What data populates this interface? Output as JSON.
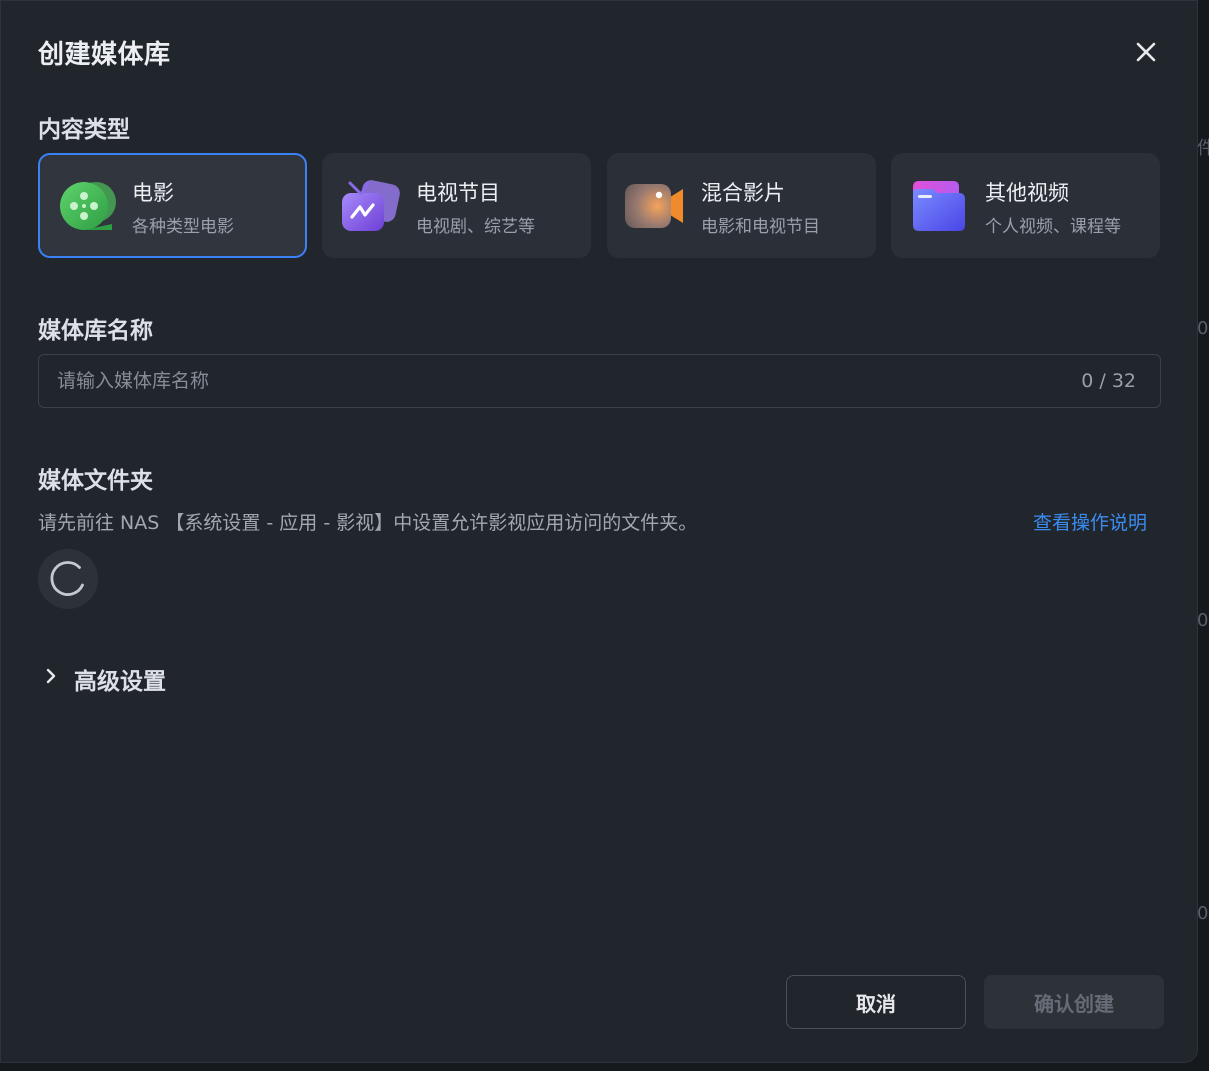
{
  "dialog": {
    "title": "创建媒体库",
    "close_icon": "close-icon"
  },
  "content_type": {
    "label": "内容类型",
    "selected": "电影",
    "cards": [
      {
        "name": "电影",
        "desc": "各种类型电影",
        "icon": "film-reel-icon",
        "color": "#4cc35a"
      },
      {
        "name": "电视节目",
        "desc": "电视剧、综艺等",
        "icon": "tv-icon",
        "color": "#8b5cf6"
      },
      {
        "name": "混合影片",
        "desc": "电影和电视节目",
        "icon": "video-camera-icon",
        "color": "#f08a2a"
      },
      {
        "name": "其他视频",
        "desc": "个人视频、课程等",
        "icon": "folder-icon",
        "color": "#5b63f5"
      }
    ]
  },
  "library_name": {
    "label": "媒体库名称",
    "placeholder": "请输入媒体库名称",
    "value": "",
    "counter": "0 / 32"
  },
  "media_folder": {
    "label": "媒体文件夹",
    "hint": "请先前往 NAS 【系统设置 - 应用 - 影视】中设置允许影视应用访问的文件夹。",
    "help_link": "查看操作说明",
    "loading_icon": "loading-spinner-icon"
  },
  "advanced": {
    "label": "高级设置",
    "icon": "chevron-right-icon"
  },
  "footer": {
    "cancel_label": "取消",
    "confirm_label": "确认创建"
  },
  "colors": {
    "accent": "#3b82f6",
    "link": "#3b8cf0",
    "dialog_bg": "#21252c",
    "card_bg": "#2b3038"
  }
}
